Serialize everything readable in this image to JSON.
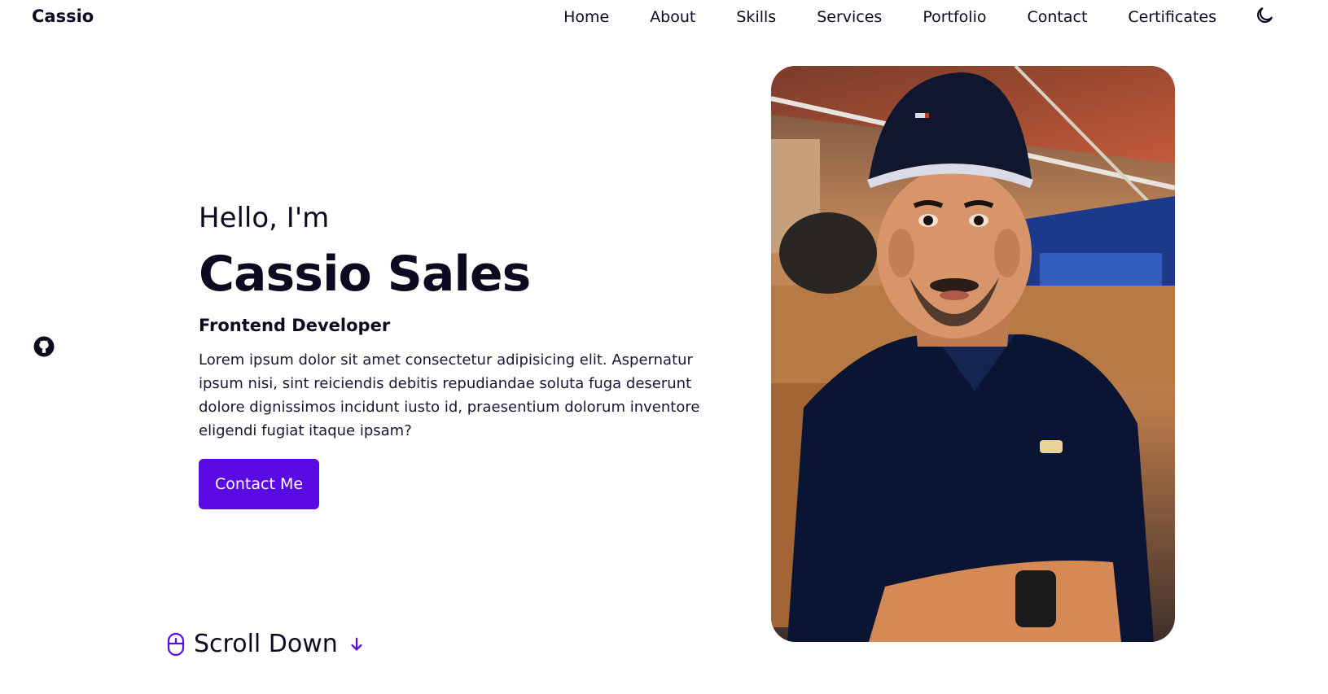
{
  "header": {
    "logo": "Cassio",
    "nav": [
      "Home",
      "About",
      "Skills",
      "Services",
      "Portfolio",
      "Contact",
      "Certificates"
    ],
    "theme_icon": "moon-icon"
  },
  "social": {
    "icon": "github-icon"
  },
  "hero": {
    "greeting": "Hello, I'm",
    "name": "Cassio Sales",
    "role": "Frontend Developer",
    "description": "Lorem ipsum dolor sit amet consectetur adipisicing elit. Aspernatur ipsum nisi, sint reiciendis debitis repudiandae soluta fuga deserunt dolore dignissimos incidunt iusto id, praesentium dolorum inventore eligendi fugiat itaque ipsam?",
    "button": "Contact Me"
  },
  "scroll": {
    "label": "Scroll Down",
    "icon": "mouse-icon",
    "arrow_icon": "arrow-down-icon"
  },
  "colors": {
    "accent": "#5a0be3",
    "text": "#0d0a1f"
  }
}
